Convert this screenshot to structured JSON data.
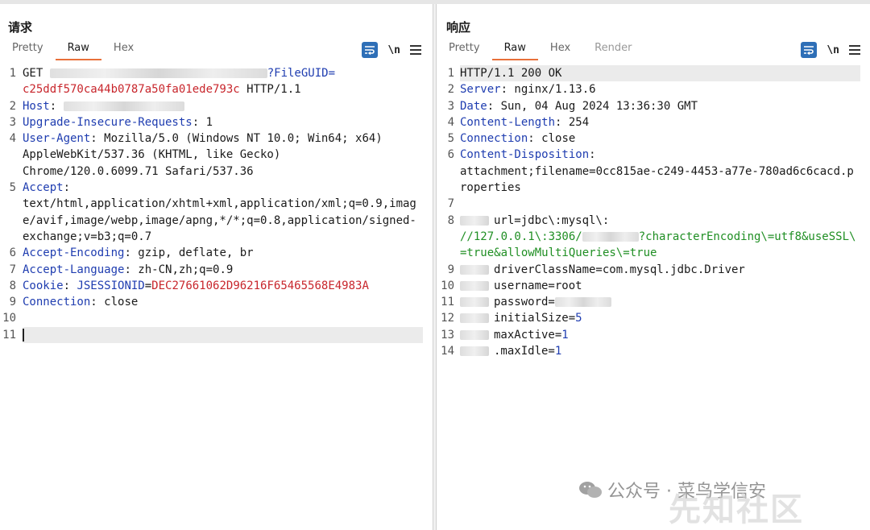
{
  "request": {
    "title": "请求",
    "tabs": [
      "Pretty",
      "Raw",
      "Hex"
    ],
    "active_tab": "Raw",
    "tools": {
      "newline": "\\n"
    },
    "lines": [
      {
        "n": "1",
        "parts": [
          [
            "",
            "GET "
          ],
          [
            "blur",
            ""
          ],
          [
            "k",
            "?FileGUID="
          ]
        ]
      },
      {
        "n": "",
        "parts": [
          [
            "r",
            "c25ddf570ca44b0787a50fa01ede793c"
          ],
          [
            "",
            " HTTP/1.1"
          ]
        ]
      },
      {
        "n": "2",
        "parts": [
          [
            "k",
            "Host"
          ],
          [
            "",
            ": "
          ],
          [
            "blur",
            ""
          ]
        ]
      },
      {
        "n": "3",
        "parts": [
          [
            "k",
            "Upgrade-Insecure-Requests"
          ],
          [
            "",
            ": 1"
          ]
        ]
      },
      {
        "n": "4",
        "parts": [
          [
            "k",
            "User-Agent"
          ],
          [
            "",
            ": Mozilla/5.0 (Windows NT 10.0; Win64; x64)"
          ]
        ]
      },
      {
        "n": "",
        "parts": [
          [
            "",
            "AppleWebKit/537.36 (KHTML, like Gecko)"
          ]
        ]
      },
      {
        "n": "",
        "parts": [
          [
            "",
            "Chrome/120.0.6099.71 Safari/537.36"
          ]
        ]
      },
      {
        "n": "5",
        "parts": [
          [
            "k",
            "Accept"
          ],
          [
            "",
            ":"
          ]
        ]
      },
      {
        "n": "",
        "parts": [
          [
            "",
            "text/html,application/xhtml+xml,application/xml;q=0.9,imag"
          ]
        ]
      },
      {
        "n": "",
        "parts": [
          [
            "",
            "e/avif,image/webp,image/apng,*/*;q=0.8,application/signed-"
          ]
        ]
      },
      {
        "n": "",
        "parts": [
          [
            "",
            "exchange;v=b3;q=0.7"
          ]
        ]
      },
      {
        "n": "6",
        "parts": [
          [
            "k",
            "Accept-Encoding"
          ],
          [
            "",
            ": gzip, deflate, br"
          ]
        ]
      },
      {
        "n": "7",
        "parts": [
          [
            "k",
            "Accept-Language"
          ],
          [
            "",
            ": zh-CN,zh;q=0.9"
          ]
        ]
      },
      {
        "n": "8",
        "parts": [
          [
            "k",
            "Cookie"
          ],
          [
            "",
            ": "
          ],
          [
            "k",
            "JSESSIONID"
          ],
          [
            "",
            "="
          ],
          [
            "r",
            "DEC27661062D96216F65465568E4983A"
          ]
        ]
      },
      {
        "n": "9",
        "parts": [
          [
            "k",
            "Connection"
          ],
          [
            "",
            ": close"
          ]
        ]
      },
      {
        "n": "10",
        "parts": []
      },
      {
        "n": "11",
        "parts": [
          [
            "cursor",
            ""
          ]
        ],
        "highlight": true
      }
    ]
  },
  "response": {
    "title": "响应",
    "tabs": [
      "Pretty",
      "Raw",
      "Hex",
      "Render"
    ],
    "active_tab": "Raw",
    "disabled_tabs": [
      "Render"
    ],
    "tools": {
      "newline": "\\n"
    },
    "lines": [
      {
        "n": "1",
        "parts": [
          [
            "",
            "HTTP/1.1 200 OK"
          ]
        ],
        "highlight": true
      },
      {
        "n": "2",
        "parts": [
          [
            "k",
            "Server"
          ],
          [
            "",
            ": nginx/1.13.6"
          ]
        ]
      },
      {
        "n": "3",
        "parts": [
          [
            "k",
            "Date"
          ],
          [
            "",
            ": Sun, 04 Aug 2024 13:36:30 GMT"
          ]
        ]
      },
      {
        "n": "4",
        "parts": [
          [
            "k",
            "Content-Length"
          ],
          [
            "",
            ": 254"
          ]
        ]
      },
      {
        "n": "5",
        "parts": [
          [
            "k",
            "Connection"
          ],
          [
            "",
            ": close"
          ]
        ]
      },
      {
        "n": "6",
        "parts": [
          [
            "k",
            "Content-Disposition"
          ],
          [
            "",
            ":"
          ]
        ]
      },
      {
        "n": "",
        "parts": [
          [
            "",
            "attachment;filename=0cc815ae-c249-4453-a77e-780ad6c6cacd.p"
          ]
        ]
      },
      {
        "n": "",
        "parts": [
          [
            "",
            "roperties"
          ]
        ]
      },
      {
        "n": "7",
        "parts": []
      },
      {
        "n": "8",
        "parts": [
          [
            "blurs",
            ""
          ],
          [
            "",
            "url=jdbc\\:mysql\\:"
          ]
        ]
      },
      {
        "n": "",
        "parts": [
          [
            "g",
            "//127.0.0.1\\:3306/"
          ],
          [
            "blur",
            ""
          ],
          [
            "g",
            "?characterEncoding\\=utf8&useSSL\\"
          ]
        ]
      },
      {
        "n": "",
        "parts": [
          [
            "g",
            "=true&allowMultiQueries\\=true"
          ]
        ]
      },
      {
        "n": "9",
        "parts": [
          [
            "blurs",
            ""
          ],
          [
            "",
            "driverClassName=com.mysql.jdbc.Driver"
          ]
        ]
      },
      {
        "n": "10",
        "parts": [
          [
            "blurs",
            ""
          ],
          [
            "",
            "username=root"
          ]
        ]
      },
      {
        "n": "11",
        "parts": [
          [
            "blurs",
            ""
          ],
          [
            "",
            "password="
          ],
          [
            "blur",
            ""
          ]
        ]
      },
      {
        "n": "12",
        "parts": [
          [
            "blurs",
            ""
          ],
          [
            "",
            "initialSize="
          ],
          [
            "bl",
            "5"
          ]
        ]
      },
      {
        "n": "13",
        "parts": [
          [
            "blurs",
            ""
          ],
          [
            "",
            "maxActive="
          ],
          [
            "bl",
            "1"
          ]
        ]
      },
      {
        "n": "14",
        "parts": [
          [
            "blurs",
            ""
          ],
          [
            "",
            ".maxIdle="
          ],
          [
            "bl",
            "1"
          ]
        ]
      }
    ]
  },
  "watermark": {
    "text": "公众号 · 菜鸟学信安",
    "logo_text": "先知社区"
  }
}
